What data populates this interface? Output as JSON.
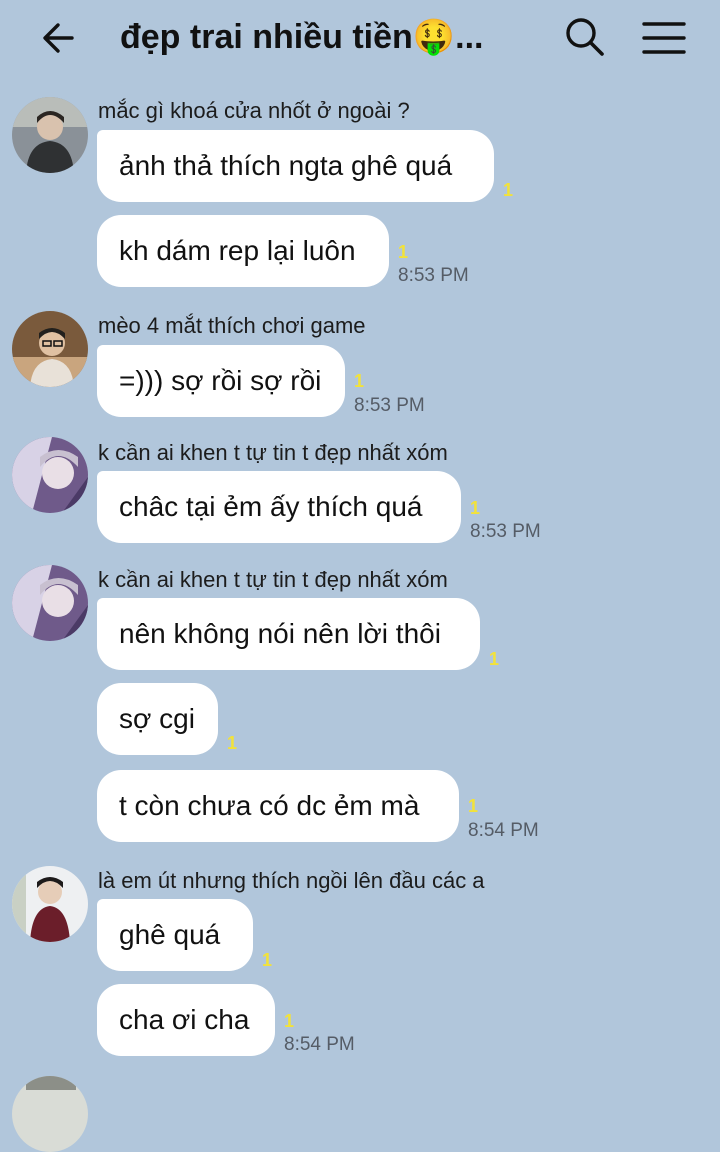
{
  "header": {
    "title": "đẹp trai nhiều tiền🤑...",
    "icons": {
      "back": "arrow-left-icon",
      "search": "search-icon",
      "menu": "hamburger-menu-icon"
    }
  },
  "groups": [
    {
      "sender": "mắc gì khoá cửa nhốt ở ngoài ?",
      "avatar": "avatar-man-dark-jacket",
      "messages": [
        {
          "text": "ảnh thả thích ngta ghê quá",
          "read": "1",
          "time": ""
        },
        {
          "text": "kh dám rep lại luôn",
          "read": "1",
          "time": "8:53 PM"
        }
      ]
    },
    {
      "sender": "mèo 4 mắt thích chơi game",
      "avatar": "avatar-man-glasses",
      "messages": [
        {
          "text": "=))) sợ rồi sợ rồi",
          "read": "1",
          "time": "8:53 PM"
        }
      ]
    },
    {
      "sender": "k cần ai khen t tự tin t đẹp nhất xóm",
      "avatar": "avatar-purple-portrait",
      "messages": [
        {
          "text": "châc tại ẻm ấy thích quá",
          "read": "1",
          "time": "8:53 PM"
        }
      ]
    },
    {
      "sender": "k cần ai khen t tự tin t đẹp nhất xóm",
      "avatar": "avatar-purple-portrait",
      "messages": [
        {
          "text": "nên không nói nên lời thôi",
          "read": "1",
          "time": ""
        },
        {
          "text": "sợ cgi",
          "read": "1",
          "time": ""
        },
        {
          "text": "t còn chưa có dc ẻm mà",
          "read": "1",
          "time": "8:54 PM"
        }
      ]
    },
    {
      "sender": "là em út nhưng thích ngồi lên đầu các a",
      "avatar": "avatar-man-red-jacket",
      "messages": [
        {
          "text": "ghê quá",
          "read": "1",
          "time": ""
        },
        {
          "text": "cha ơi cha",
          "read": "1",
          "time": "8:54 PM"
        }
      ]
    }
  ],
  "colors": {
    "background": "#b1c6db",
    "bubble": "#ffffff",
    "read_count": "#f2e23a",
    "time": "#555c66"
  }
}
